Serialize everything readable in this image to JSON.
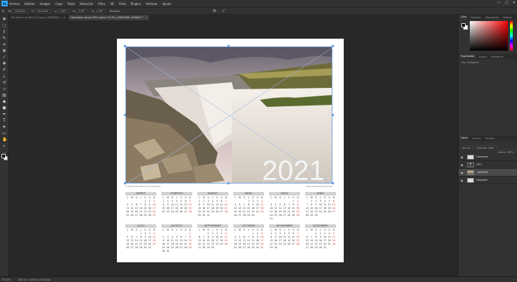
{
  "menu": [
    "Archivo",
    "Edición",
    "Imagen",
    "Capa",
    "Texto",
    "Selección",
    "Filtro",
    "3D",
    "Vista",
    "Plugins",
    "Ventana",
    "Ayuda"
  ],
  "app_logo": "Ps",
  "window_controls": [
    "—",
    "□",
    "✕"
  ],
  "options": {
    "zoom": "100%",
    "w": "124,42%",
    "h": "124,42%",
    "angle": "0,00°",
    "h_skew": "0,00°",
    "v_skew": "0,00°",
    "interp": "Bicúbica"
  },
  "tabs": [
    {
      "label": "Sin título-1 al 66,7% (Capa 4, RGB/8#) *",
      "active": false
    },
    {
      "label": "Calendario Anual 2021.psd al 33,3% (_SNO0969, RGB/8*) *",
      "active": true
    }
  ],
  "document": {
    "year": "2021",
    "credit_left": "© Daniel Miralles para Fotografia",
    "credit_right": "http://www.fotoventas.es",
    "months": [
      {
        "name": "ENERO",
        "start": 4,
        "days": 31
      },
      {
        "name": "FEBRERO",
        "start": 0,
        "days": 28
      },
      {
        "name": "MARZO",
        "start": 0,
        "days": 31
      },
      {
        "name": "ABRIL",
        "start": 3,
        "days": 30
      },
      {
        "name": "MAYO",
        "start": 5,
        "days": 31
      },
      {
        "name": "JUNIO",
        "start": 1,
        "days": 30
      },
      {
        "name": "JULIO",
        "start": 3,
        "days": 31
      },
      {
        "name": "AGOSTO",
        "start": 6,
        "days": 31
      },
      {
        "name": "SEPTIEMBRE",
        "start": 2,
        "days": 30
      },
      {
        "name": "OCTUBRE",
        "start": 4,
        "days": 31
      },
      {
        "name": "NOVIEMBRE",
        "start": 0,
        "days": 30
      },
      {
        "name": "DICIEMBRE",
        "start": 2,
        "days": 31
      }
    ],
    "weekdays": [
      "L",
      "M",
      "X",
      "J",
      "V",
      "S",
      "D"
    ]
  },
  "panels": {
    "color_tabs": [
      "Color",
      "Muestras",
      "Degradados",
      "Motivos"
    ],
    "props_tabs": [
      "Propiedades",
      "Ajustes",
      "Bibliotecas"
    ],
    "props_label": "Obj. inteligente",
    "layers_tabs": [
      "Capas",
      "Canales",
      "Trazados"
    ],
    "blend_mode": "Normal",
    "opacity": "Opacidad: 100%",
    "fill": "Relleno: 100%",
    "layers": [
      {
        "name": "Calendario",
        "type": "plain",
        "selected": false
      },
      {
        "name": "2021",
        "type": "text",
        "selected": false
      },
      {
        "name": "_SNO0969",
        "type": "image",
        "selected": true
      },
      {
        "name": "Fotografía",
        "type": "plain",
        "selected": false
      }
    ]
  },
  "status": {
    "zoom": "33,33%",
    "doc": "3500 px x 3500 px (300 ppp)"
  }
}
